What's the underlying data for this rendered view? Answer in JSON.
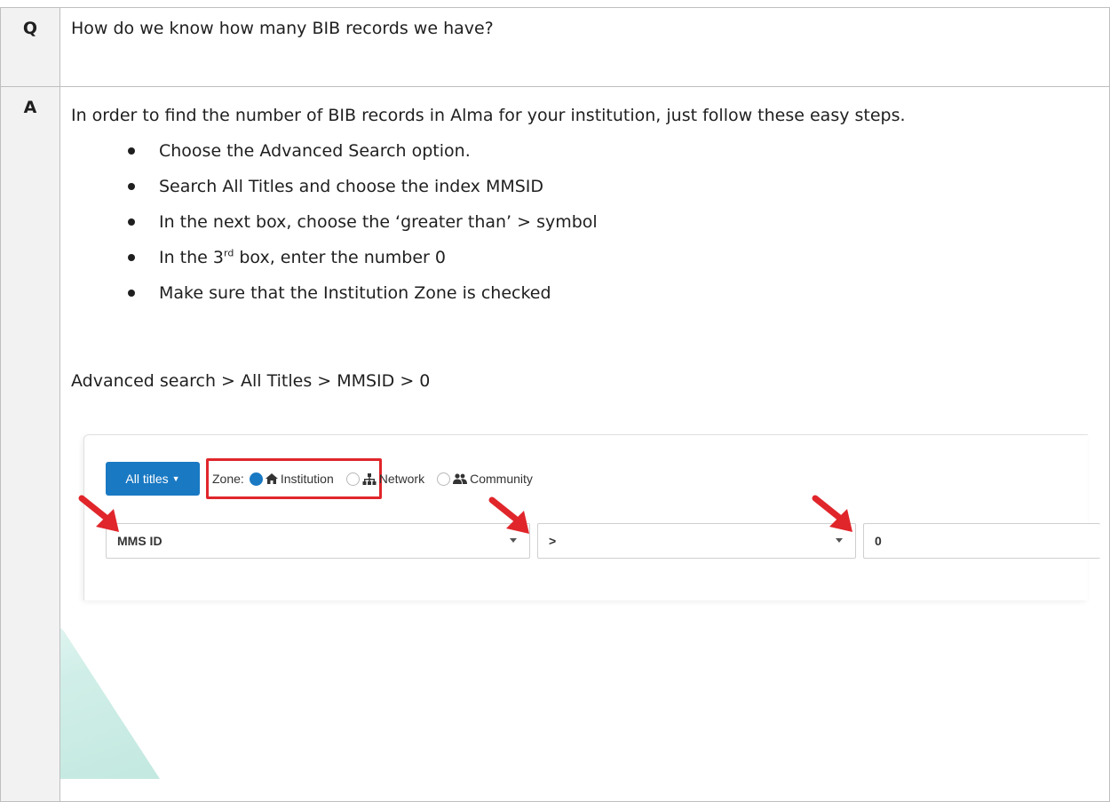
{
  "qa": {
    "q_letter": "Q",
    "question": "How do we know how many BIB records we have?",
    "a_letter": "A",
    "intro": "In order to find the number of BIB records in Alma for your institution, just follow these easy steps.",
    "steps": [
      "Choose the Advanced Search option.",
      "Search All Titles and choose the index MMSID",
      "In the next box, choose the ‘greater than’ > symbol",
      {
        "before": "In the 3",
        "sup": "rd",
        "after": " box, enter the number 0"
      },
      "Make sure that the Institution Zone is checked"
    ],
    "path": "Advanced search > All Titles > MMSID > 0"
  },
  "screenshot": {
    "all_titles_label": "All titles",
    "zone_label": "Zone:",
    "zones": [
      {
        "label": "Institution",
        "icon": "home-icon",
        "selected": true
      },
      {
        "label": "Network",
        "icon": "network-icon",
        "selected": false
      },
      {
        "label": "Community",
        "icon": "community-icon",
        "selected": false
      }
    ],
    "index_field": "MMS ID",
    "operator_field": ">",
    "value_field": "0",
    "highlight_color": "#e0262b",
    "button_color": "#1a79c3",
    "arrow_color": "#e0262b"
  }
}
